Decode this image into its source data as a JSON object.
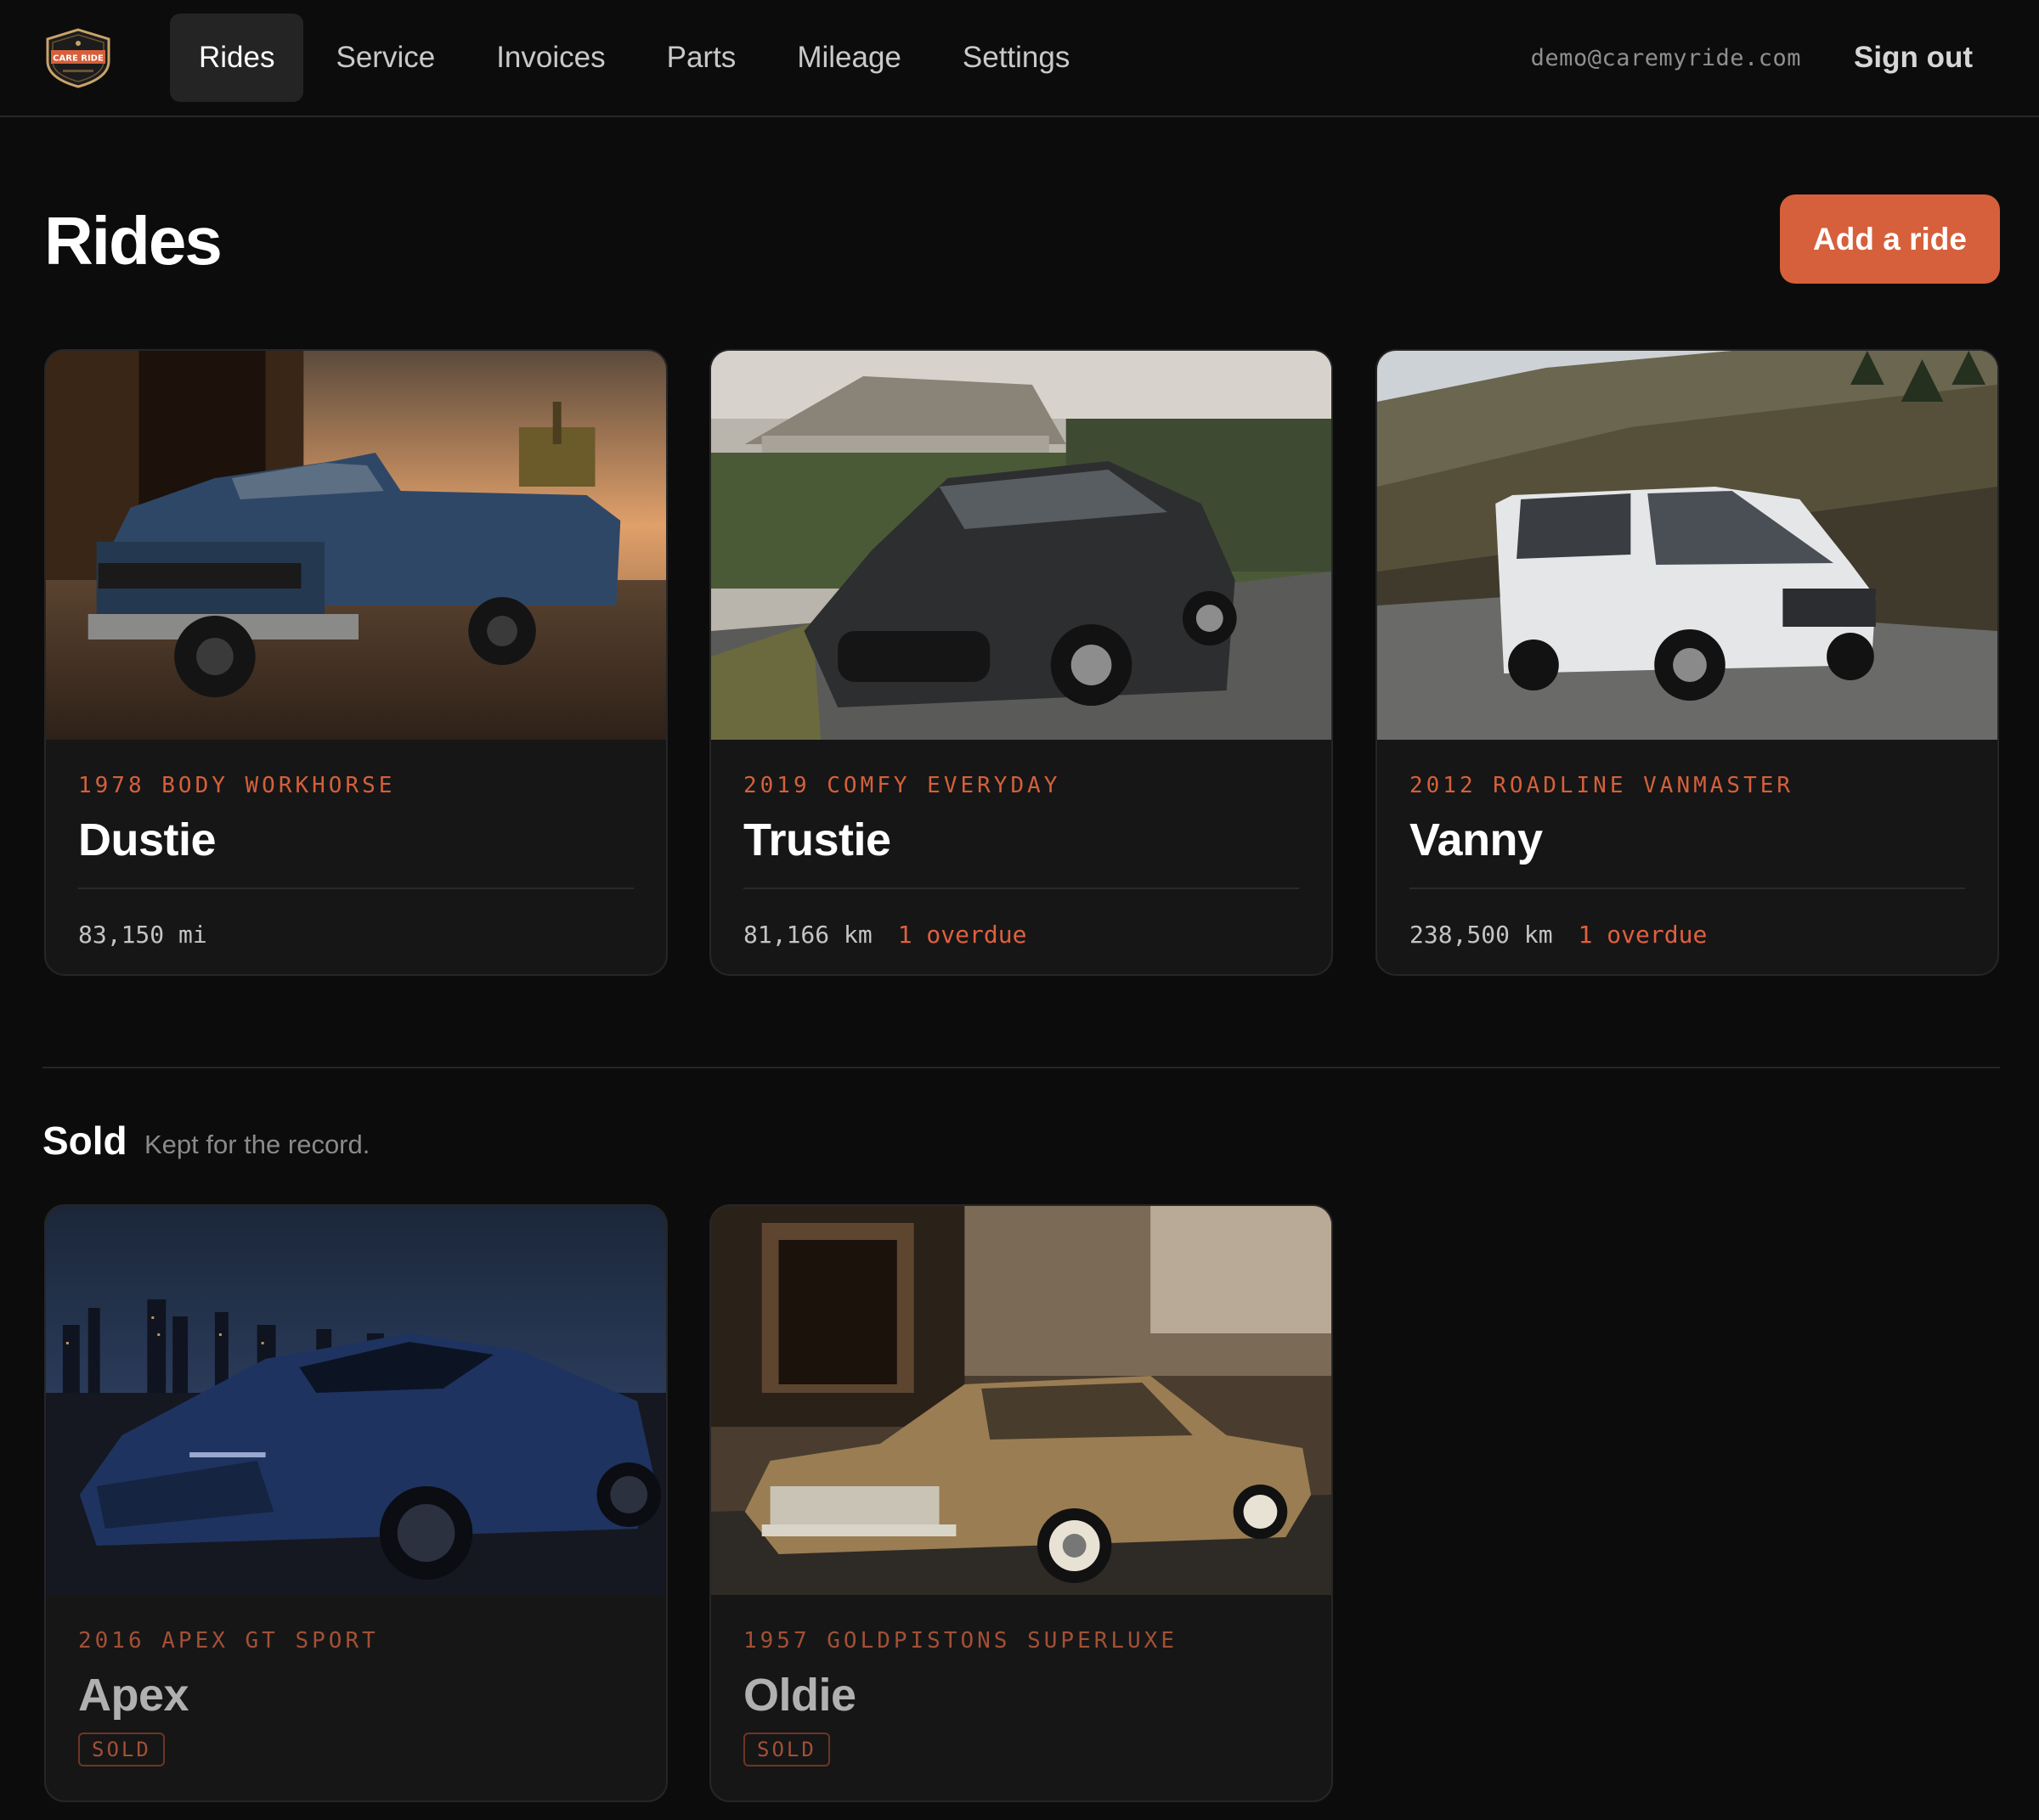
{
  "nav": {
    "logo_text": "CARE MY RIDE",
    "items": [
      {
        "label": "Rides",
        "active": true
      },
      {
        "label": "Service",
        "active": false
      },
      {
        "label": "Invoices",
        "active": false
      },
      {
        "label": "Parts",
        "active": false
      },
      {
        "label": "Mileage",
        "active": false
      },
      {
        "label": "Settings",
        "active": false
      }
    ],
    "user_email": "demo@caremyride.com",
    "signout_label": "Sign out"
  },
  "page": {
    "title": "Rides",
    "add_button_label": "Add a ride",
    "accent_color": "#d5603b"
  },
  "rides": [
    {
      "subtitle": "1978 BODY WORKHORSE",
      "name": "Dustie",
      "mileage": "83,150 mi",
      "overdue": "",
      "photo": "blue-pickup-truck-photo"
    },
    {
      "subtitle": "2019 COMFY EVERYDAY",
      "name": "Trustie",
      "mileage": "81,166 km",
      "overdue": "1 overdue",
      "photo": "dark-hatchback-photo"
    },
    {
      "subtitle": "2012 ROADLINE VANMASTER",
      "name": "Vanny",
      "mileage": "238,500 km",
      "overdue": "1 overdue",
      "photo": "white-van-photo"
    }
  ],
  "sold": {
    "heading": "Sold",
    "subtitle": "Kept for the record.",
    "items": [
      {
        "subtitle": "2016 APEX GT SPORT",
        "name": "Apex",
        "badge": "SOLD",
        "photo": "blue-sports-car-photo"
      },
      {
        "subtitle": "1957 GOLDPISTONS SUPERLUXE",
        "name": "Oldie",
        "badge": "SOLD",
        "photo": "gold-classic-car-photo"
      }
    ]
  }
}
